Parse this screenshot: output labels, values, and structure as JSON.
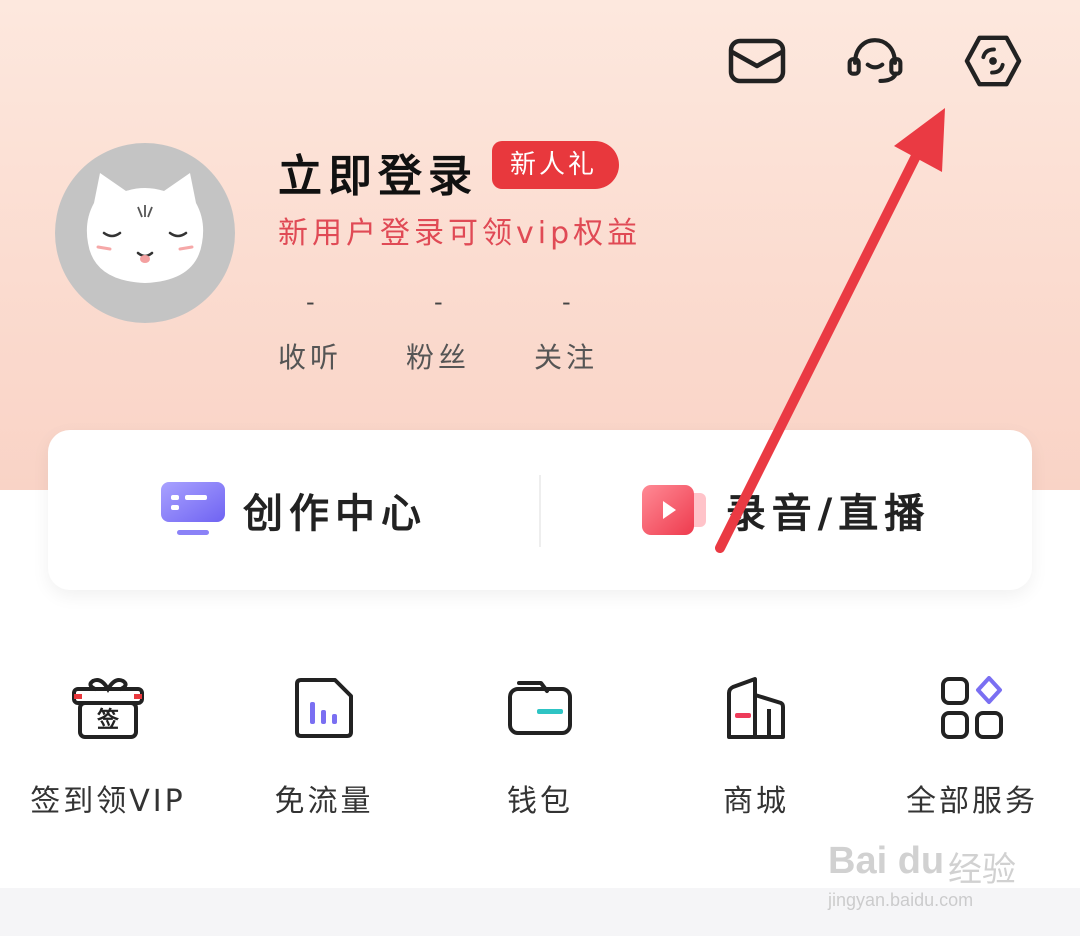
{
  "header": {
    "icons": [
      "mail-icon",
      "customer-service-icon",
      "scan-icon"
    ]
  },
  "profile": {
    "title": "立即登录",
    "badge": "新人礼",
    "subtitle": "新用户登录可领vip权益",
    "stats": [
      {
        "value": "-",
        "label": "收听"
      },
      {
        "value": "-",
        "label": "粉丝"
      },
      {
        "value": "-",
        "label": "关注"
      }
    ]
  },
  "card": {
    "left_label": "创作中心",
    "right_label": "录音/直播"
  },
  "services": [
    {
      "label": "签到领VIP",
      "icon": "gift-sign-icon",
      "icon_text": "签"
    },
    {
      "label": "免流量",
      "icon": "data-free-icon"
    },
    {
      "label": "钱包",
      "icon": "wallet-icon"
    },
    {
      "label": "商城",
      "icon": "mall-icon"
    },
    {
      "label": "全部服务",
      "icon": "all-services-icon"
    }
  ],
  "watermark": {
    "logo": "Bai du",
    "text": "经验",
    "url": "jingyan.baidu.com"
  },
  "colors": {
    "accent": "#e8383d",
    "subtitle": "#e04a55",
    "arrow": "#ea3a43",
    "hero_bg": "#fbdcd0"
  }
}
